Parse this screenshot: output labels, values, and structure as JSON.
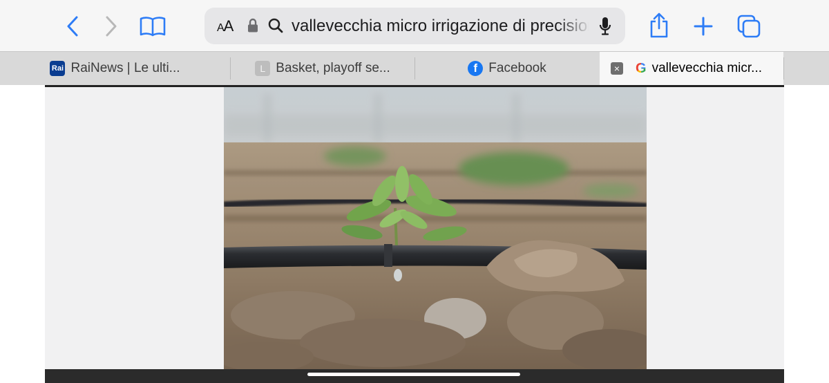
{
  "toolbar": {
    "back_icon": "chevron-left-icon",
    "forward_icon": "chevron-right-icon",
    "bookmarks_icon": "book-icon",
    "share_icon": "share-icon",
    "new_tab_icon": "plus-icon",
    "tabs_icon": "tabs-overview-icon",
    "accent": "#2d7cf6"
  },
  "address": {
    "aa_label": "AA",
    "url_text": "vallevecchia micro irrigazione di precisione",
    "lock_icon": "lock-icon",
    "search_icon": "search-icon",
    "mic_icon": "microphone-icon"
  },
  "tabs": [
    {
      "favicon": "Rai",
      "title": "RaiNews | Le ulti..."
    },
    {
      "favicon": "L",
      "title": "Basket, playoff se..."
    },
    {
      "favicon": "f",
      "title": "Facebook"
    },
    {
      "favicon": "G",
      "title": "vallevecchia micr...",
      "active": true,
      "close": "×"
    }
  ],
  "page": {
    "image_subject": "drip-irrigation-seedling-photo"
  }
}
